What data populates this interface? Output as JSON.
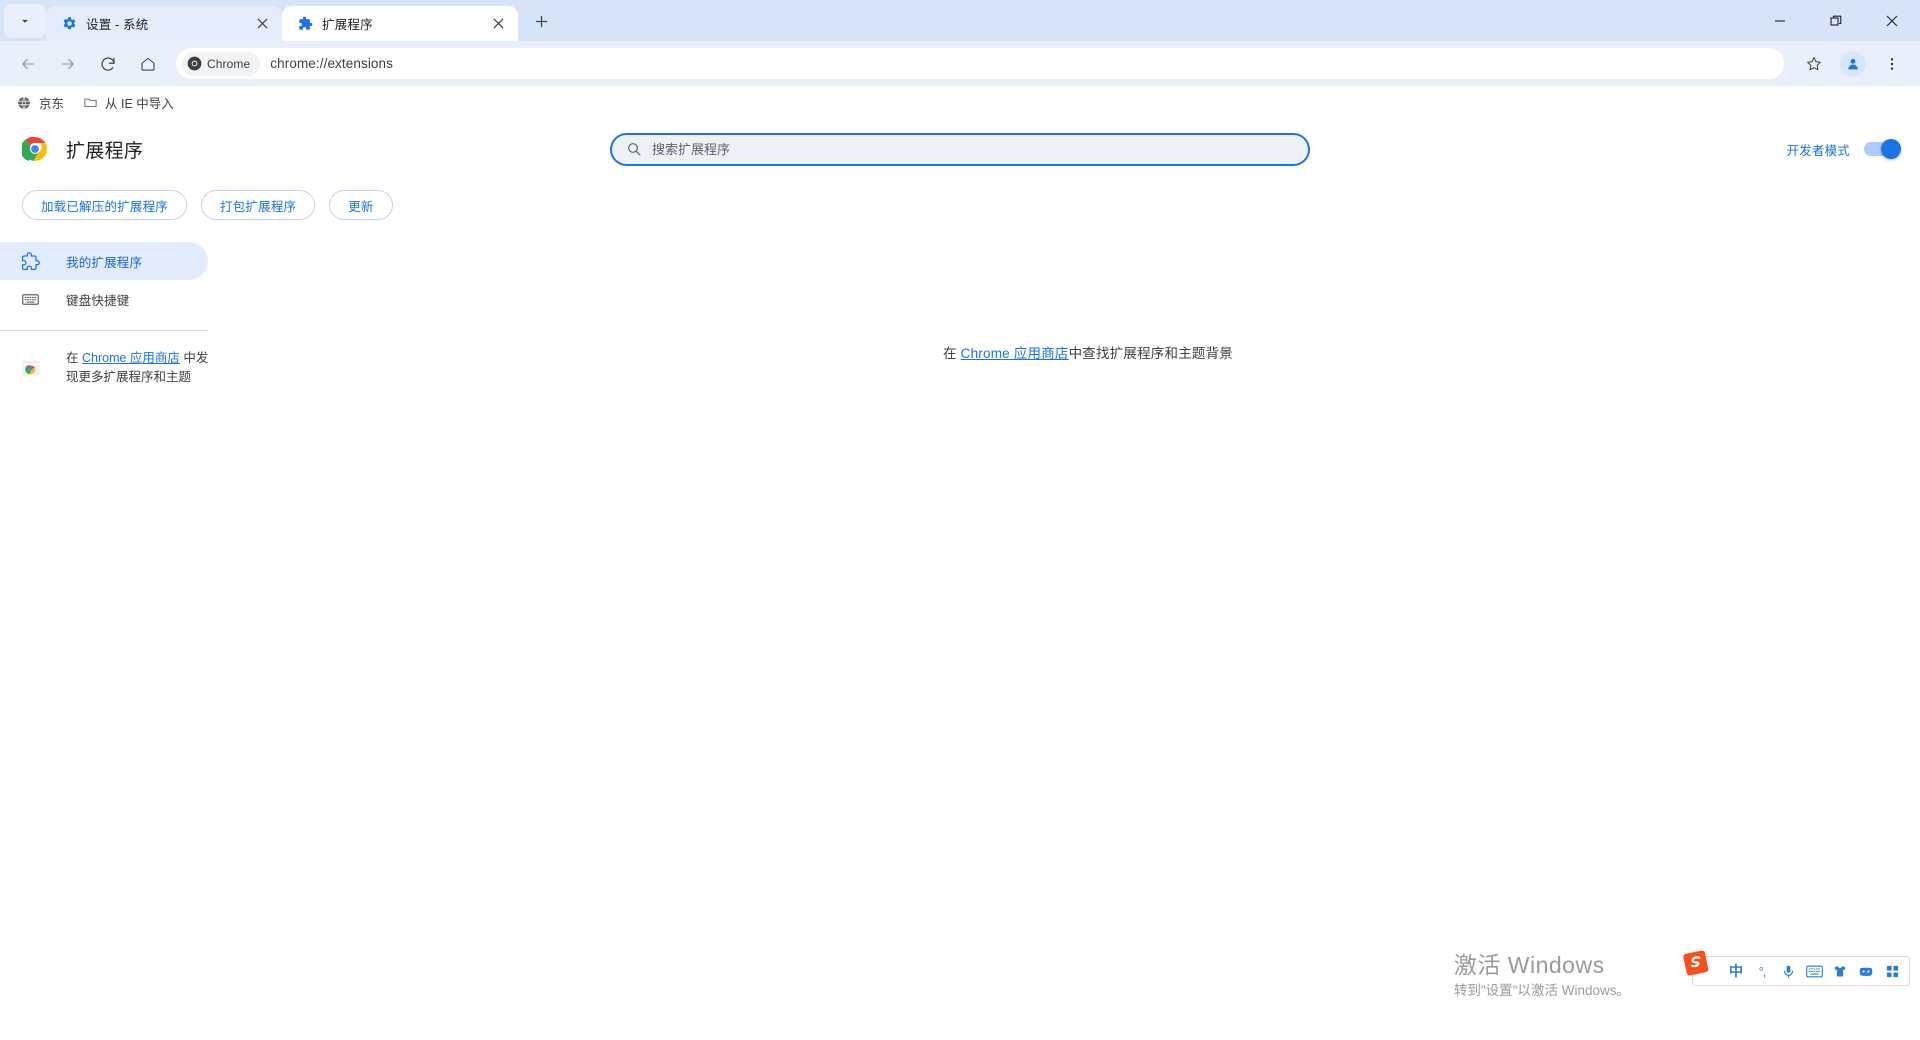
{
  "window": {
    "controls": {
      "minimize": "—",
      "maximize": "❐",
      "close": "✕"
    },
    "tab_search_icon": "chevron-down-icon"
  },
  "tabs": [
    {
      "title": "设置 - 系统",
      "favicon": "gear-icon",
      "active": false,
      "close": "✕"
    },
    {
      "title": "扩展程序",
      "favicon": "puzzle-icon",
      "active": true,
      "close": "✕"
    }
  ],
  "new_tab_label": "+",
  "toolbar": {
    "back_icon": "arrow-left-icon",
    "forward_icon": "arrow-right-icon",
    "reload_icon": "reload-icon",
    "home_icon": "home-icon",
    "chip_label": "Chrome",
    "url": "chrome://extensions",
    "bookmark_star_icon": "star-icon",
    "profile_icon": "avatar-icon",
    "menu_icon": "three-dot-menu-icon"
  },
  "bookmarks": [
    {
      "label": "京东",
      "icon": "globe-icon"
    },
    {
      "label": "从 IE 中导入",
      "icon": "folder-icon"
    }
  ],
  "extensions_page": {
    "logo": "chrome-logo-icon",
    "title": "扩展程序",
    "search": {
      "placeholder": "搜索扩展程序",
      "value": "",
      "icon": "search-icon"
    },
    "dev_mode": {
      "label": "开发者模式",
      "enabled": true,
      "accent": "#1a73e8"
    },
    "actions": [
      {
        "label": "加载已解压的扩展程序"
      },
      {
        "label": "打包扩展程序"
      },
      {
        "label": "更新"
      }
    ],
    "sidebar": {
      "items": [
        {
          "label": "我的扩展程序",
          "icon": "puzzle-icon",
          "selected": true
        },
        {
          "label": "键盘快捷键",
          "icon": "keyboard-icon",
          "selected": false
        }
      ],
      "footer": {
        "icon": "chrome-web-store-icon",
        "prefix": "在 ",
        "link": "Chrome 应用商店",
        "suffix": " 中发现更多扩展程序和主题"
      }
    },
    "empty_state": {
      "prefix": "在 ",
      "link": "Chrome 应用商店",
      "suffix": "中查找扩展程序和主题背景"
    }
  },
  "watermark": {
    "line1": "激活 Windows",
    "line2": "转到\"设置\"以激活 Windows。"
  },
  "ime": {
    "logo": "sogou-logo-icon",
    "items": [
      {
        "name": "chinese-mode",
        "glyph": "中"
      },
      {
        "name": "punctuation-mode",
        "glyph": "°,"
      },
      {
        "name": "voice-input-icon",
        "glyph": "mic"
      },
      {
        "name": "soft-keyboard-icon",
        "glyph": "keyboard"
      },
      {
        "name": "skin-icon",
        "glyph": "shirt"
      },
      {
        "name": "emoji-icon",
        "glyph": "face"
      },
      {
        "name": "toolbox-icon",
        "glyph": "grid"
      }
    ]
  },
  "colors": {
    "tabstrip_bg": "#d7e3f8",
    "toolbar_bg": "#eaf0fb",
    "accent_blue": "#1a73e8",
    "sidebar_selected": "#e3ecfd"
  }
}
